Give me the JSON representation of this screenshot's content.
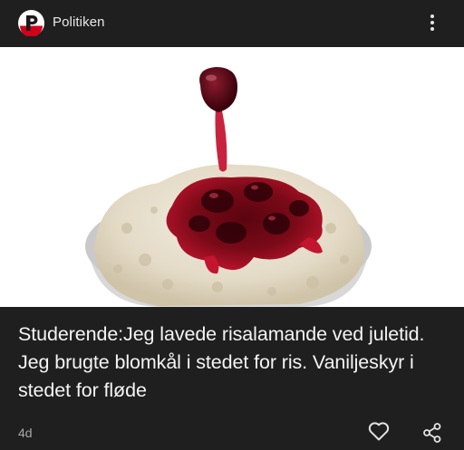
{
  "source": {
    "name": "Politiken",
    "logo_icon": "politiken-logo",
    "brand_color": "#d0021b"
  },
  "menu": {
    "icon": "more-vert-icon"
  },
  "article": {
    "image_description_icon": "rice-pudding-cherry-sauce-photo",
    "headline": "Studerende:Jeg lavede risalamande ved juletid. Jeg brugte blomkål i stedet for ris. Vaniljeskyr i stedet for fløde",
    "age": "4d"
  },
  "actions": {
    "like_icon": "heart-icon",
    "share_icon": "share-icon"
  },
  "colors": {
    "background": "#1f1f1f",
    "text": "#f4f4f4",
    "muted": "#a9a9a9"
  }
}
